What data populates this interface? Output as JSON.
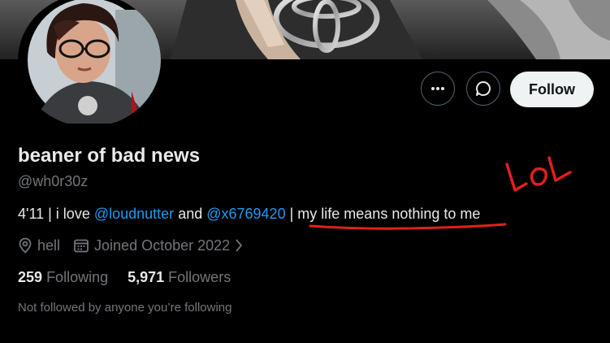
{
  "profile": {
    "display_name": "beaner of bad news",
    "handle": "@wh0r30z",
    "bio": {
      "prefix": "4'11 | i love ",
      "mention_1": "@loudnutter",
      "middle": " and ",
      "mention_2": "@x6769420",
      "separator": " | ",
      "underlined": "my life means nothing to me"
    },
    "location": "hell",
    "joined": "Joined October 2022",
    "following_count": "259",
    "following_label": "Following",
    "followers_count": "5,971",
    "followers_label": "Followers",
    "followed_by_notice": "Not followed by anyone you’re following"
  },
  "actions": {
    "more_icon": "more-icon",
    "message_icon": "message-icon",
    "follow_label": "Follow"
  },
  "annotation": {
    "handwritten_text": "LOL",
    "color": "#e0201c"
  },
  "colors": {
    "background": "#000000",
    "primary_text": "#e7e9ea",
    "secondary_text": "#71767b",
    "link": "#1d9bf0",
    "follow_button_bg": "#eff3f4"
  }
}
